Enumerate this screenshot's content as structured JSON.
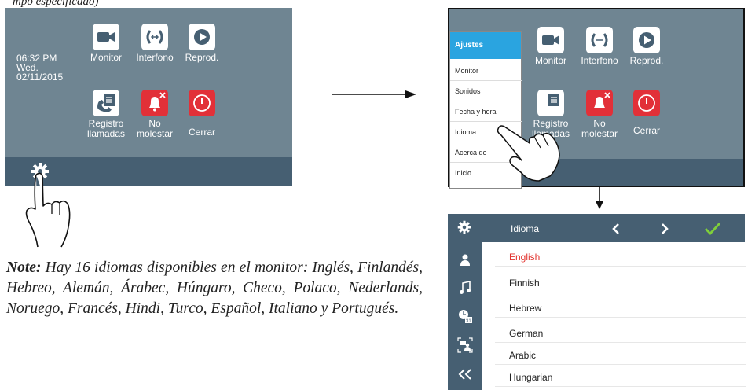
{
  "top_left_fragment": "mpo especificado)",
  "home": {
    "clock": {
      "time": "06:32 PM",
      "day": "Wed.",
      "date": "02/11/2015"
    },
    "tiles": [
      {
        "label": "Monitor",
        "icon": "camera-icon"
      },
      {
        "label": "Interfono",
        "icon": "intercom-icon"
      },
      {
        "label": "Reprod.",
        "icon": "play-icon"
      },
      {
        "label": "Registro llamadas",
        "line1": "Registro",
        "line2": "llamadas",
        "icon": "call-log-icon"
      },
      {
        "label": "No molestar",
        "line1": "No",
        "line2": "molestar",
        "icon": "do-not-disturb-bell-icon"
      },
      {
        "label": "Cerrar",
        "icon": "power-icon"
      }
    ],
    "settings_icon": "gear-icon"
  },
  "settings_menu": {
    "title": "Ajustes",
    "items": [
      "Monitor",
      "Sonidos",
      "Fecha y hora",
      "Idioma",
      "Acerca de",
      "Inicio"
    ]
  },
  "language_screen": {
    "header": "Idioma",
    "languages": [
      "English",
      "Finnish",
      "Hebrew",
      "German",
      "Arabic",
      "Hungarian"
    ],
    "selected": "English",
    "colors": {
      "selected": "#e3342f",
      "confirm": "#7fcf3a",
      "header": "#465f72"
    }
  },
  "note": {
    "label": "Note:",
    "text": "Hay 16 idiomas disponibles en el monitor: Inglés, Finlandés, Hebreo, Alemán, Árabec, Húngaro, Checo, Polaco, Nederlands, Noruego, Francés, Hindi, Turco, Español, Italiano y Portugués."
  }
}
